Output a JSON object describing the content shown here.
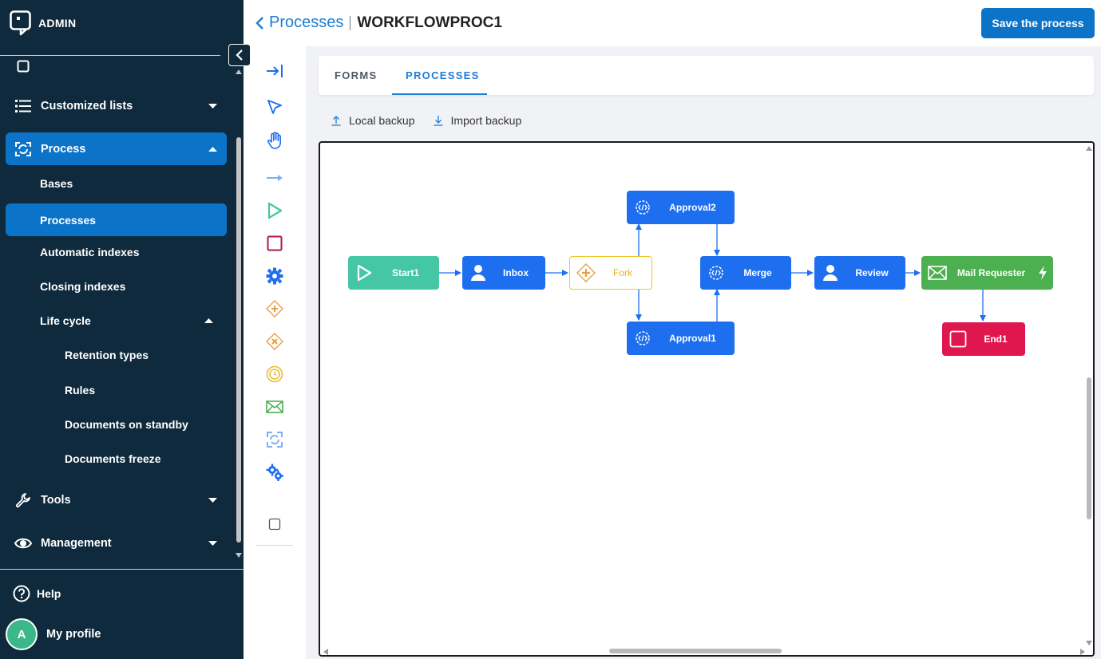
{
  "app": {
    "name": "ADMIN"
  },
  "sidebar": {
    "items": [
      {
        "label": "Customized lists",
        "icon": "list-icon"
      },
      {
        "label": "Process",
        "icon": "process-icon"
      },
      {
        "label": "Tools",
        "icon": "wrench-icon"
      },
      {
        "label": "Management",
        "icon": "eye-icon"
      }
    ],
    "process_sub": [
      "Bases",
      "Processes",
      "Automatic indexes",
      "Closing indexes",
      "Life cycle"
    ],
    "lifecycle_sub": [
      "Retention types",
      "Rules",
      "Documents on standby",
      "Documents freeze"
    ],
    "help_label": "Help",
    "profile_initial": "A",
    "profile_label": "My profile"
  },
  "header": {
    "breadcrumb_link": "Processes",
    "breadcrumb_current": "WORKFLOWPROC1",
    "save_label": "Save the process"
  },
  "toolbar": {
    "tools": [
      "collapse-panel-icon",
      "select-pointer-icon",
      "hand-pan-icon",
      "connector-arrow-icon",
      "start-play-icon",
      "end-square-icon",
      "task-gear-icon",
      "fork-gateway-icon",
      "exclusive-gateway-icon",
      "timer-event-icon",
      "mail-icon",
      "subprocess-icon",
      "script-gears-icon",
      "checkbox-icon"
    ]
  },
  "tabs": {
    "forms": "FORMS",
    "processes": "PROCESSES",
    "active": "PROCESSES"
  },
  "backup": {
    "local": "Local backup",
    "import": "Import backup"
  },
  "diagram": {
    "nodes": {
      "start1": "Start1",
      "inbox": "Inbox",
      "fork": "Fork",
      "approval2": "Approval2",
      "approval1": "Approval1",
      "merge": "Merge",
      "review": "Review",
      "mail_requester": "Mail Requester",
      "end1": "End1"
    }
  },
  "colors": {
    "sidebar_bg": "#0f2a3d",
    "accent": "#0b73c8",
    "node_blue": "#1e6fef",
    "node_start": "#45c6a5",
    "node_fork_border": "#f1c62b",
    "node_mail": "#4caf50",
    "node_end": "#e0164f"
  }
}
